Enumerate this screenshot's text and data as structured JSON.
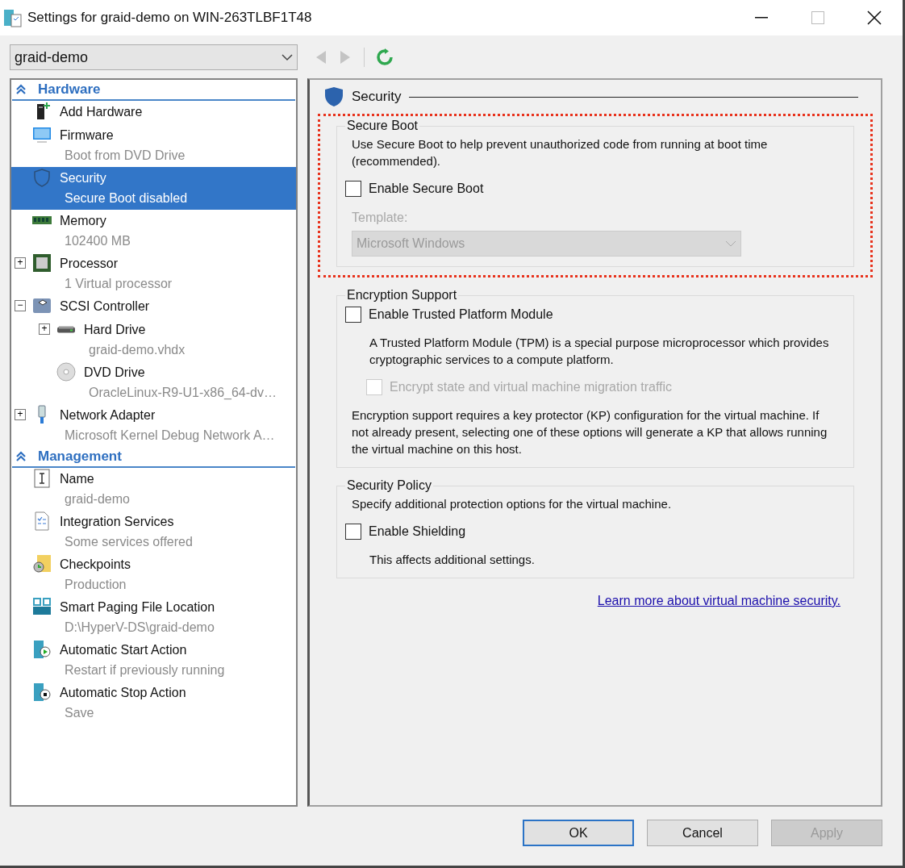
{
  "window": {
    "title": "Settings for graid-demo on WIN-263TLBF1T48"
  },
  "vm_selector": {
    "value": "graid-demo"
  },
  "toolbar": {
    "back": {
      "disabled": true
    },
    "forward": {
      "disabled": true
    }
  },
  "sidebar": {
    "sections": [
      {
        "title": "Hardware",
        "items": [
          {
            "label": "Add Hardware",
            "selected": false
          },
          {
            "label": "Firmware",
            "detail": "Boot from DVD Drive",
            "selected": false
          },
          {
            "label": "Security",
            "detail": "Secure Boot disabled",
            "selected": true
          },
          {
            "label": "Memory",
            "detail": "102400 MB",
            "selected": false
          },
          {
            "label": "Processor",
            "detail": "1 Virtual processor",
            "toggle": "+",
            "selected": false
          },
          {
            "label": "SCSI Controller",
            "toggle": "−",
            "selected": false,
            "children": [
              {
                "label": "Hard Drive",
                "detail": "graid-demo.vhdx",
                "toggle": "+",
                "selected": false
              },
              {
                "label": "DVD Drive",
                "detail": "OracleLinux-R9-U1-x86_64-dv…",
                "selected": false
              }
            ]
          },
          {
            "label": "Network Adapter",
            "detail": "Microsoft Kernel Debug Network A…",
            "toggle": "+",
            "selected": false
          }
        ]
      },
      {
        "title": "Management",
        "items": [
          {
            "label": "Name",
            "detail": "graid-demo",
            "selected": false
          },
          {
            "label": "Integration Services",
            "detail": "Some services offered",
            "selected": false
          },
          {
            "label": "Checkpoints",
            "detail": "Production",
            "selected": false
          },
          {
            "label": "Smart Paging File Location",
            "detail": "D:\\HyperV-DS\\graid-demo",
            "selected": false
          },
          {
            "label": "Automatic Start Action",
            "detail": "Restart if previously running",
            "selected": false
          },
          {
            "label": "Automatic Stop Action",
            "detail": "Save",
            "selected": false
          }
        ]
      }
    ]
  },
  "panel": {
    "heading": "Security",
    "groups": [
      {
        "title": "Secure Boot",
        "highlighted": true,
        "rows": [
          {
            "kind": "text",
            "text": "Use Secure Boot to help prevent unauthorized code from running at boot time (recommended)."
          },
          {
            "kind": "checkbox",
            "label": "Enable Secure Boot",
            "checked": false,
            "disabled": false,
            "indent": false
          },
          {
            "kind": "select",
            "label": "Template:",
            "value": "Microsoft Windows",
            "disabled": true
          }
        ]
      },
      {
        "title": "Encryption Support",
        "highlighted": false,
        "rows": [
          {
            "kind": "checkbox",
            "label": "Enable Trusted Platform Module",
            "checked": false,
            "disabled": false,
            "indent": false
          },
          {
            "kind": "note",
            "text": "A Trusted Platform Module (TPM) is a special purpose microprocessor which provides cryptographic services to a compute platform."
          },
          {
            "kind": "checkbox",
            "label": "Encrypt state and virtual machine migration traffic",
            "checked": false,
            "disabled": true,
            "indent": true
          },
          {
            "kind": "text",
            "text": "Encryption support requires a key protector (KP) configuration for the virtual machine. If not already present, selecting one of these options will generate a KP that allows running the virtual machine on this host."
          }
        ]
      },
      {
        "title": "Security Policy",
        "highlighted": false,
        "rows": [
          {
            "kind": "text",
            "text": "Specify additional protection options for the virtual machine."
          },
          {
            "kind": "checkbox",
            "label": "Enable Shielding",
            "checked": false,
            "disabled": false,
            "indent": false
          },
          {
            "kind": "note",
            "text": "This affects additional settings."
          }
        ]
      }
    ],
    "link": "Learn more about virtual machine security."
  },
  "buttons": [
    {
      "label": "OK",
      "default": true,
      "disabled": false
    },
    {
      "label": "Cancel",
      "default": false,
      "disabled": false
    },
    {
      "label": "Apply",
      "default": false,
      "disabled": true
    }
  ]
}
